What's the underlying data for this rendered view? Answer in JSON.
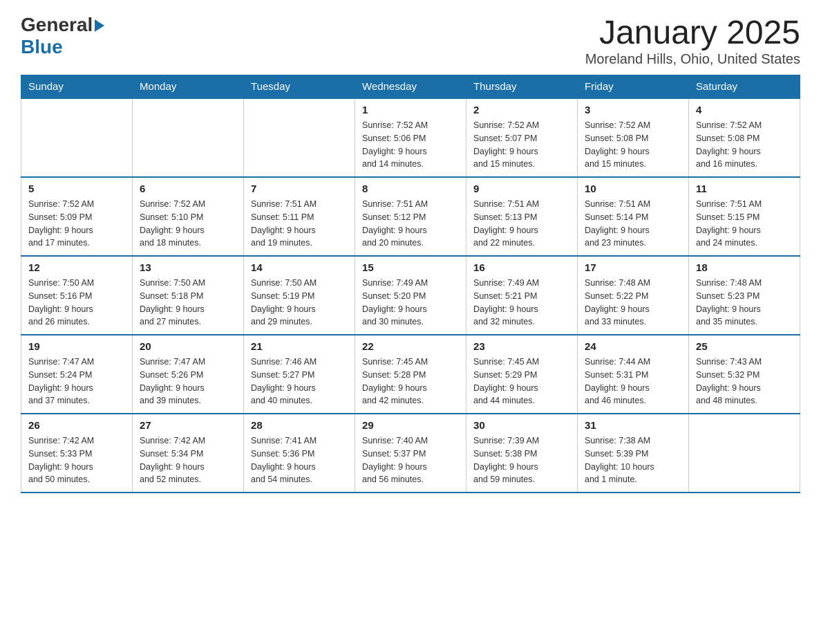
{
  "logo": {
    "general": "General",
    "blue": "Blue"
  },
  "title": "January 2025",
  "subtitle": "Moreland Hills, Ohio, United States",
  "days_of_week": [
    "Sunday",
    "Monday",
    "Tuesday",
    "Wednesday",
    "Thursday",
    "Friday",
    "Saturday"
  ],
  "weeks": [
    [
      {
        "day": "",
        "info": ""
      },
      {
        "day": "",
        "info": ""
      },
      {
        "day": "",
        "info": ""
      },
      {
        "day": "1",
        "info": "Sunrise: 7:52 AM\nSunset: 5:06 PM\nDaylight: 9 hours\nand 14 minutes."
      },
      {
        "day": "2",
        "info": "Sunrise: 7:52 AM\nSunset: 5:07 PM\nDaylight: 9 hours\nand 15 minutes."
      },
      {
        "day": "3",
        "info": "Sunrise: 7:52 AM\nSunset: 5:08 PM\nDaylight: 9 hours\nand 15 minutes."
      },
      {
        "day": "4",
        "info": "Sunrise: 7:52 AM\nSunset: 5:08 PM\nDaylight: 9 hours\nand 16 minutes."
      }
    ],
    [
      {
        "day": "5",
        "info": "Sunrise: 7:52 AM\nSunset: 5:09 PM\nDaylight: 9 hours\nand 17 minutes."
      },
      {
        "day": "6",
        "info": "Sunrise: 7:52 AM\nSunset: 5:10 PM\nDaylight: 9 hours\nand 18 minutes."
      },
      {
        "day": "7",
        "info": "Sunrise: 7:51 AM\nSunset: 5:11 PM\nDaylight: 9 hours\nand 19 minutes."
      },
      {
        "day": "8",
        "info": "Sunrise: 7:51 AM\nSunset: 5:12 PM\nDaylight: 9 hours\nand 20 minutes."
      },
      {
        "day": "9",
        "info": "Sunrise: 7:51 AM\nSunset: 5:13 PM\nDaylight: 9 hours\nand 22 minutes."
      },
      {
        "day": "10",
        "info": "Sunrise: 7:51 AM\nSunset: 5:14 PM\nDaylight: 9 hours\nand 23 minutes."
      },
      {
        "day": "11",
        "info": "Sunrise: 7:51 AM\nSunset: 5:15 PM\nDaylight: 9 hours\nand 24 minutes."
      }
    ],
    [
      {
        "day": "12",
        "info": "Sunrise: 7:50 AM\nSunset: 5:16 PM\nDaylight: 9 hours\nand 26 minutes."
      },
      {
        "day": "13",
        "info": "Sunrise: 7:50 AM\nSunset: 5:18 PM\nDaylight: 9 hours\nand 27 minutes."
      },
      {
        "day": "14",
        "info": "Sunrise: 7:50 AM\nSunset: 5:19 PM\nDaylight: 9 hours\nand 29 minutes."
      },
      {
        "day": "15",
        "info": "Sunrise: 7:49 AM\nSunset: 5:20 PM\nDaylight: 9 hours\nand 30 minutes."
      },
      {
        "day": "16",
        "info": "Sunrise: 7:49 AM\nSunset: 5:21 PM\nDaylight: 9 hours\nand 32 minutes."
      },
      {
        "day": "17",
        "info": "Sunrise: 7:48 AM\nSunset: 5:22 PM\nDaylight: 9 hours\nand 33 minutes."
      },
      {
        "day": "18",
        "info": "Sunrise: 7:48 AM\nSunset: 5:23 PM\nDaylight: 9 hours\nand 35 minutes."
      }
    ],
    [
      {
        "day": "19",
        "info": "Sunrise: 7:47 AM\nSunset: 5:24 PM\nDaylight: 9 hours\nand 37 minutes."
      },
      {
        "day": "20",
        "info": "Sunrise: 7:47 AM\nSunset: 5:26 PM\nDaylight: 9 hours\nand 39 minutes."
      },
      {
        "day": "21",
        "info": "Sunrise: 7:46 AM\nSunset: 5:27 PM\nDaylight: 9 hours\nand 40 minutes."
      },
      {
        "day": "22",
        "info": "Sunrise: 7:45 AM\nSunset: 5:28 PM\nDaylight: 9 hours\nand 42 minutes."
      },
      {
        "day": "23",
        "info": "Sunrise: 7:45 AM\nSunset: 5:29 PM\nDaylight: 9 hours\nand 44 minutes."
      },
      {
        "day": "24",
        "info": "Sunrise: 7:44 AM\nSunset: 5:31 PM\nDaylight: 9 hours\nand 46 minutes."
      },
      {
        "day": "25",
        "info": "Sunrise: 7:43 AM\nSunset: 5:32 PM\nDaylight: 9 hours\nand 48 minutes."
      }
    ],
    [
      {
        "day": "26",
        "info": "Sunrise: 7:42 AM\nSunset: 5:33 PM\nDaylight: 9 hours\nand 50 minutes."
      },
      {
        "day": "27",
        "info": "Sunrise: 7:42 AM\nSunset: 5:34 PM\nDaylight: 9 hours\nand 52 minutes."
      },
      {
        "day": "28",
        "info": "Sunrise: 7:41 AM\nSunset: 5:36 PM\nDaylight: 9 hours\nand 54 minutes."
      },
      {
        "day": "29",
        "info": "Sunrise: 7:40 AM\nSunset: 5:37 PM\nDaylight: 9 hours\nand 56 minutes."
      },
      {
        "day": "30",
        "info": "Sunrise: 7:39 AM\nSunset: 5:38 PM\nDaylight: 9 hours\nand 59 minutes."
      },
      {
        "day": "31",
        "info": "Sunrise: 7:38 AM\nSunset: 5:39 PM\nDaylight: 10 hours\nand 1 minute."
      },
      {
        "day": "",
        "info": ""
      }
    ]
  ]
}
